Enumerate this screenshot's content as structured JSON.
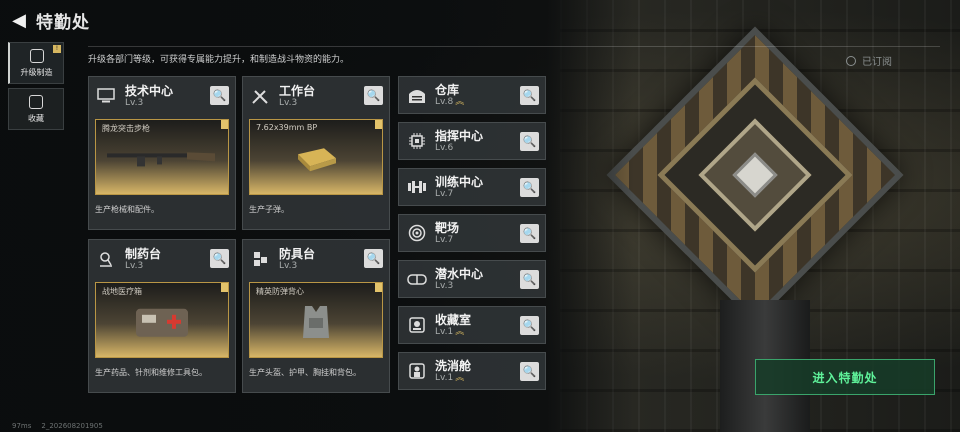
{
  "header": {
    "back_symbol": "◀",
    "title": "特勤处"
  },
  "description": "升级各部门等级，可获得专属能力提升，和制造战斗物资的能力。",
  "sidebar": {
    "items": [
      {
        "label": "升级制造",
        "icon": "upgrade-icon",
        "active": true,
        "flag": "!"
      },
      {
        "label": "收藏",
        "icon": "collection-icon",
        "active": false
      }
    ]
  },
  "cards": [
    {
      "name": "技术中心",
      "level": "Lv.3",
      "icon": "computer-icon",
      "product": "腾龙突击步枪",
      "desc": "生产枪械和配件。"
    },
    {
      "name": "工作台",
      "level": "Lv.3",
      "icon": "tools-icon",
      "product": "7.62x39mm BP",
      "desc": "生产子弹。"
    },
    {
      "name": "制药台",
      "level": "Lv.3",
      "icon": "microscope-icon",
      "product": "战地医疗箱",
      "desc": "生产药品、针剂和维修工具包。"
    },
    {
      "name": "防具台",
      "level": "Lv.3",
      "icon": "armor-icon",
      "product": "精英防弹背心",
      "desc": "生产头盔、护甲、胸挂和背包。"
    }
  ],
  "departments": [
    {
      "name": "仓库",
      "level": "Lv.8",
      "icon": "warehouse-icon",
      "upgrade": true
    },
    {
      "name": "指挥中心",
      "level": "Lv.6",
      "icon": "chip-icon",
      "upgrade": false
    },
    {
      "name": "训练中心",
      "level": "Lv.7",
      "icon": "dumbbell-icon",
      "upgrade": false
    },
    {
      "name": "靶场",
      "level": "Lv.7",
      "icon": "target-icon",
      "upgrade": false
    },
    {
      "name": "潜水中心",
      "level": "Lv.3",
      "icon": "diving-icon",
      "upgrade": false
    },
    {
      "name": "收藏室",
      "level": "Lv.1",
      "icon": "collection-room-icon",
      "upgrade": true
    },
    {
      "name": "洗消舱",
      "level": "Lv.1",
      "icon": "decon-icon",
      "upgrade": true
    }
  ],
  "upgrade_mark": "︽",
  "search_symbol": "🔍",
  "subscribed": "已订阅",
  "enter_button": "进入特勤处",
  "footer": {
    "ping": "97ms",
    "build": "2_202608201905"
  },
  "colors": {
    "accent_gold": "#d6b760",
    "enter_green": "#5ff29a"
  }
}
